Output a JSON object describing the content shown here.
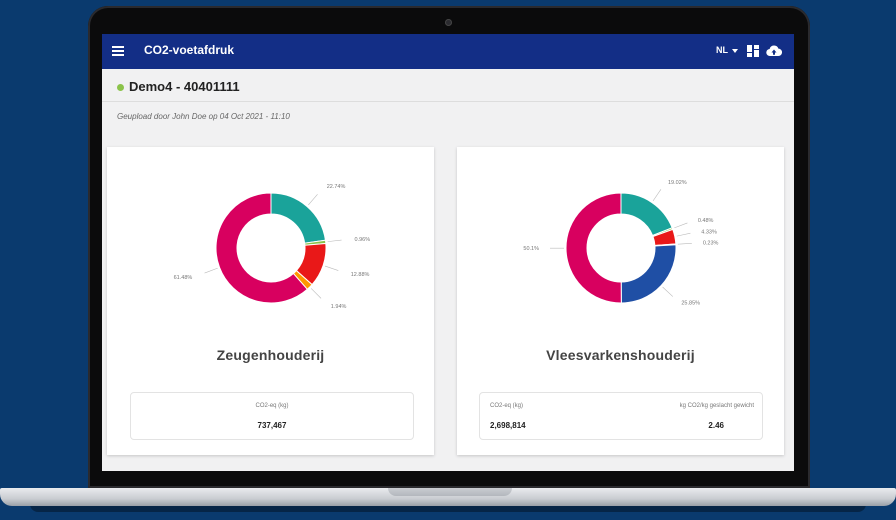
{
  "app": {
    "title": "CO2-voetafdruk",
    "language": "NL"
  },
  "farm": {
    "title": "Demo4 - 40401111",
    "upload_info": "Geupload door John Doe op 04 Oct 2021 - 11:10"
  },
  "cards": [
    {
      "title": "Zeugenhouderij",
      "slices": [
        {
          "value": 22.74,
          "label": "22.74%",
          "color": "#1aa39a"
        },
        {
          "value": 0.96,
          "label": "0.96%",
          "color": "#8bc34a"
        },
        {
          "value": 12.88,
          "label": "12.88%",
          "color": "#e91818"
        },
        {
          "value": 1.94,
          "label": "1.94%",
          "color": "#ff9800"
        },
        {
          "value": 61.48,
          "label": "61.48%",
          "color": "#d8005f"
        }
      ],
      "stats": [
        {
          "label": "CO2-eq (kg)",
          "value": "737,467"
        }
      ]
    },
    {
      "title": "Vleesvarkenshouderij",
      "slices": [
        {
          "value": 19.02,
          "label": "19.02%",
          "color": "#1aa39a"
        },
        {
          "value": 0.48,
          "label": "0.48%",
          "color": "#8bc34a"
        },
        {
          "value": 4.33,
          "label": "4.33%",
          "color": "#e91818"
        },
        {
          "value": 0.23,
          "label": "0.23%",
          "color": "#ff9800"
        },
        {
          "value": 25.85,
          "label": "25.85%",
          "color": "#1f4fa5"
        },
        {
          "value": 50.1,
          "label": "50.1%",
          "color": "#d8005f"
        }
      ],
      "stats": [
        {
          "label": "CO2-eq (kg)",
          "value": "2,698,814"
        },
        {
          "label": "kg CO2/kg geslacht gewicht",
          "value": "2.46"
        }
      ]
    }
  ]
}
